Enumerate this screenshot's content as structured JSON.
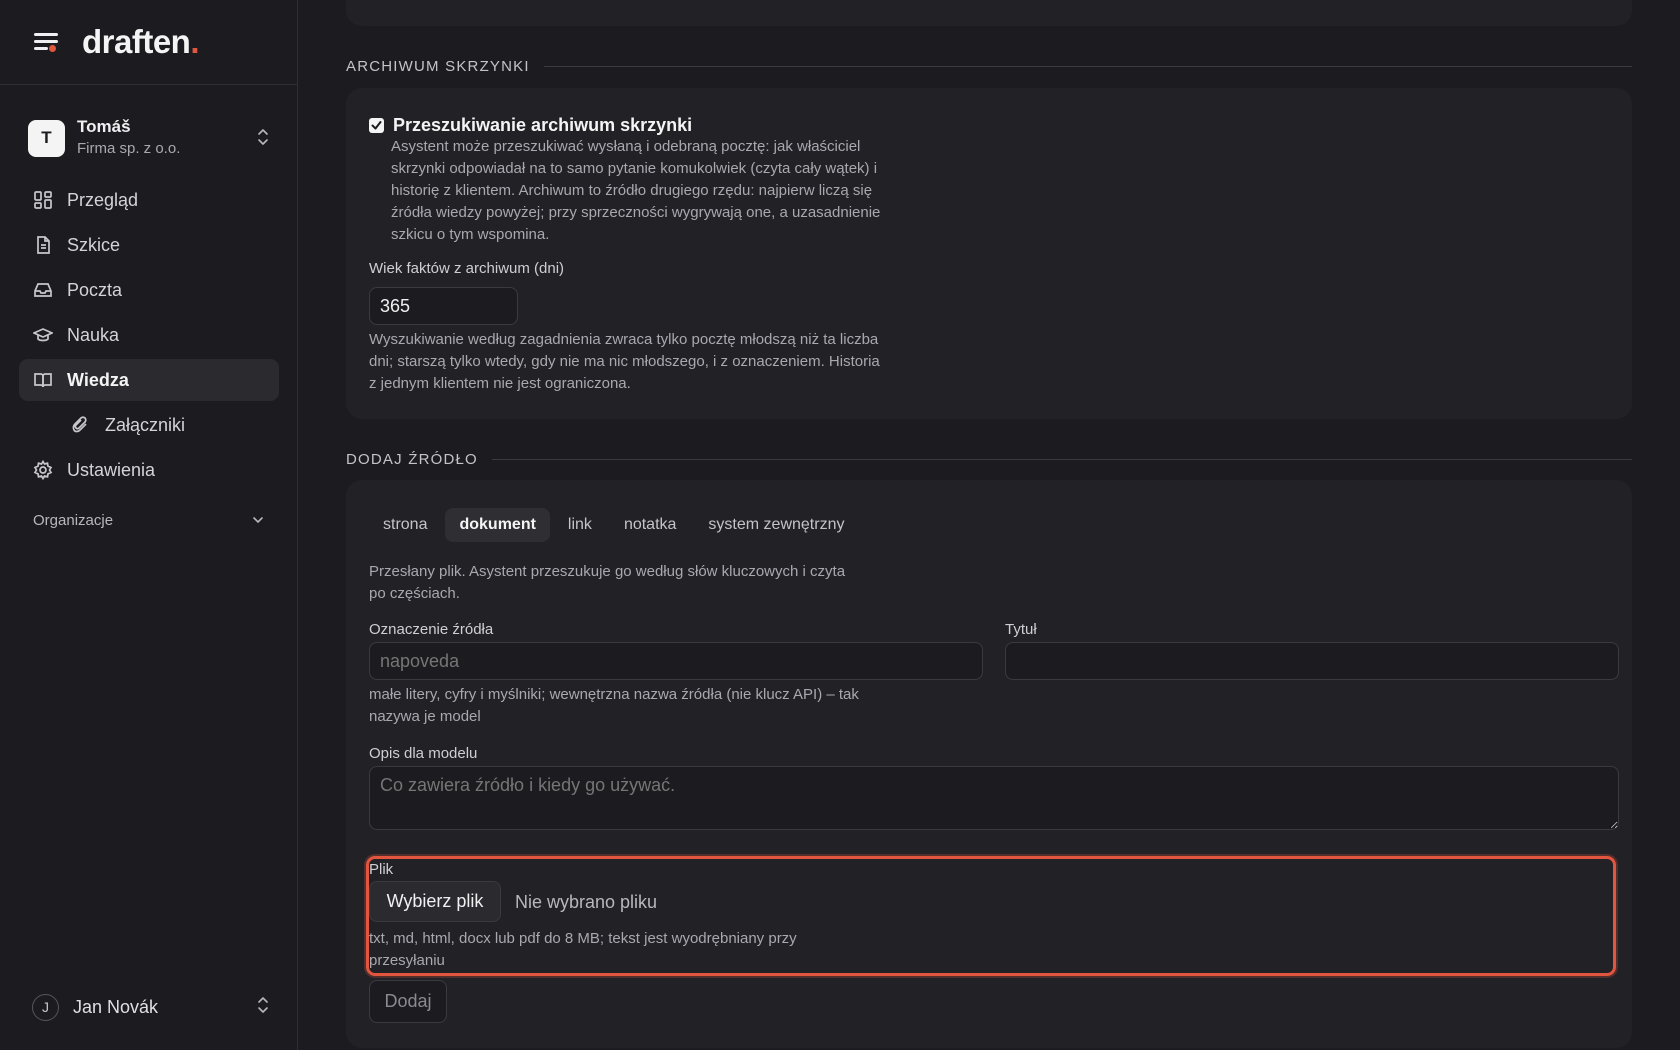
{
  "brand": {
    "logo": "draften",
    "logo_dot": "."
  },
  "org": {
    "initial": "T",
    "name": "Tomáš",
    "company": "Firma sp. z o.o."
  },
  "nav": {
    "items": [
      {
        "label": "Przegląd"
      },
      {
        "label": "Szkice"
      },
      {
        "label": "Poczta"
      },
      {
        "label": "Nauka"
      },
      {
        "label": "Wiedza"
      },
      {
        "label": "Załączniki"
      },
      {
        "label": "Ustawienia"
      }
    ],
    "section_label": "Organizacje"
  },
  "user": {
    "initial": "J",
    "name": "Jan Novák"
  },
  "archive": {
    "section_title": "ARCHIWUM SKRZYNKI",
    "checkbox_label": "Przeszukiwanie archiwum skrzynki",
    "checkbox_checked": true,
    "checkbox_help": "Asystent może przeszukiwać wysłaną i odebraną pocztę: jak właściciel skrzynki odpowiadał na to samo pytanie komukolwiek (czyta cały wątek) i historię z klientem. Archiwum to źródło drugiego rzędu: najpierw liczą się źródła wiedzy powyżej; przy sprzeczności wygrywają one, a uzasadnienie szkicu o tym wspomina.",
    "age_label": "Wiek faktów z archiwum (dni)",
    "age_value": "365",
    "age_help": "Wyszukiwanie według zagadnienia zwraca tylko pocztę młodszą niż ta liczba dni; starszą tylko wtedy, gdy nie ma nic młodszego, i z oznaczeniem. Historia z jednym klientem nie jest ograniczona."
  },
  "add_source": {
    "section_title": "DODAJ ŹRÓDŁO",
    "tabs": [
      "strona",
      "dokument",
      "link",
      "notatka",
      "system zewnętrzny"
    ],
    "active_tab": "dokument",
    "tab_description": "Przesłany plik. Asystent przeszukuje go według słów kluczowych i czyta po częściach.",
    "source_id_label": "Oznaczenie źródła",
    "source_id_placeholder": "napoveda",
    "source_id_help": "małe litery, cyfry i myślniki; wewnętrzna nazwa źródła (nie klucz API) – tak nazywa je model",
    "title_label": "Tytuł",
    "title_value": "",
    "description_label": "Opis dla modelu",
    "description_placeholder": "Co zawiera źródło i kiedy go używać.",
    "file_label": "Plik",
    "file_button": "Wybierz plik",
    "file_status": "Nie wybrano pliku",
    "file_help": "txt, md, html, docx lub pdf do 8 MB; tekst jest wyodrębniany przy przesyłaniu",
    "submit_label": "Dodaj"
  },
  "colors": {
    "accent": "#e2553f",
    "background": "#1c1c20",
    "card": "#222226"
  }
}
